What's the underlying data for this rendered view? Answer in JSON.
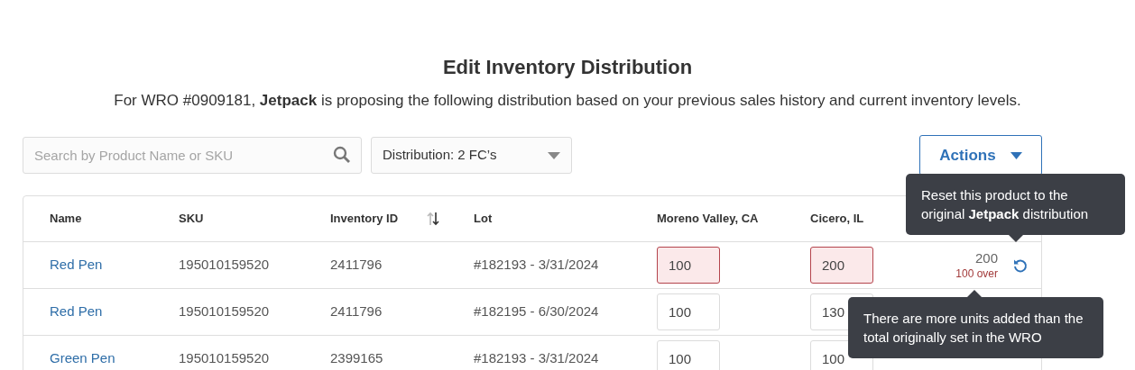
{
  "title": "Edit Inventory Distribution",
  "subtitle": "For WRO #0909181, **Jetpack** is proposing the following distribution based on your previous sales history and current inventory levels.",
  "search": {
    "placeholder": "Search by Product Name or SKU"
  },
  "distribution_select": {
    "value": "Distribution: 2 FC’s"
  },
  "actions_button": "Actions",
  "table": {
    "columns": [
      {
        "label": "Name",
        "sortable": false
      },
      {
        "label": "SKU",
        "sortable": false
      },
      {
        "label": "Inventory ID",
        "sortable": true
      },
      {
        "label": "Lot",
        "sortable": false
      },
      {
        "label": "Moreno Valley, CA",
        "sortable": false
      },
      {
        "label": "Cicero, IL",
        "sortable": false
      }
    ],
    "rows": [
      {
        "name": "Red Pen",
        "sku": "195010159520",
        "inventory_id": "2411796",
        "lot": "#182193 - 3/31/2024",
        "moreno_valley": "100",
        "cicero": "200",
        "flagged": true,
        "total": "200",
        "over": "100 over"
      },
      {
        "name": "Red Pen",
        "sku": "195010159520",
        "inventory_id": "2411796",
        "lot": "#182195 - 6/30/2024",
        "moreno_valley": "100",
        "cicero": "130",
        "flagged": false
      },
      {
        "name": "Green Pen",
        "sku": "195010159520",
        "inventory_id": "2399165",
        "lot": "#182193 - 3/31/2024",
        "moreno_valley": "100",
        "cicero": "100",
        "flagged": false
      }
    ]
  },
  "tooltips": [
    {
      "kind": "reset",
      "text": "Reset this product to the original **Jetpack** distribution"
    },
    {
      "kind": "over",
      "text": "There are more units added than the total originally set in the WRO"
    }
  ]
}
